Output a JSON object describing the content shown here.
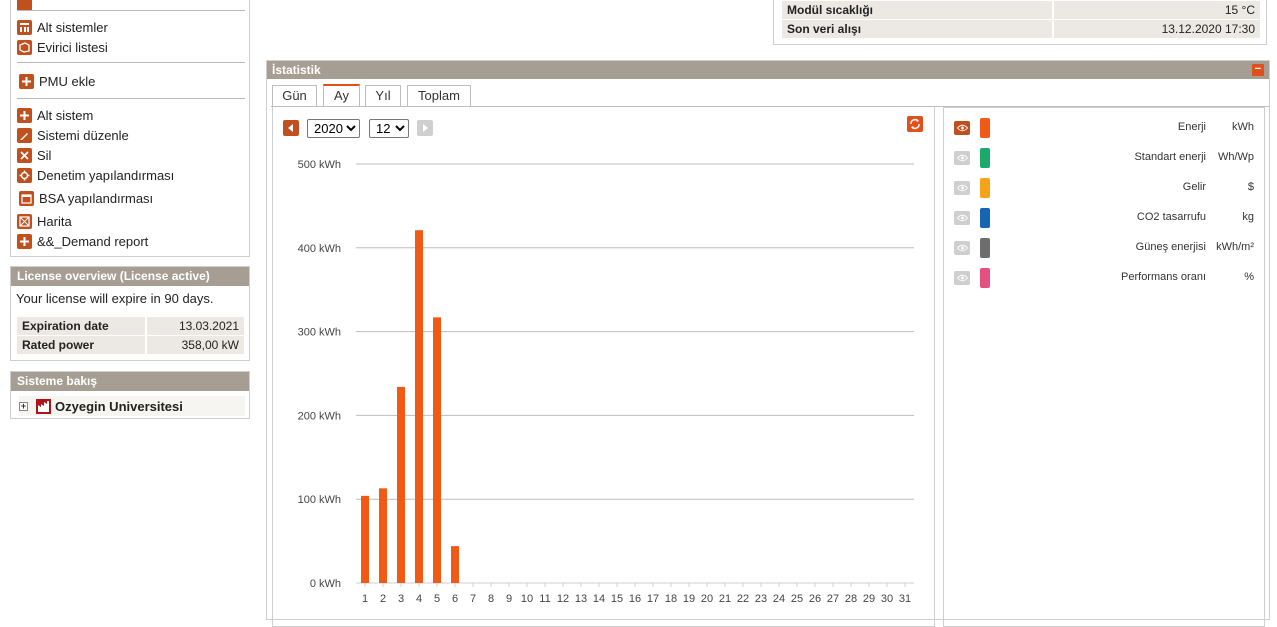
{
  "sidebar": {
    "items": [
      {
        "label": "Alt sistemler",
        "icon": "subsystems-icon"
      },
      {
        "label": "Evirici listesi",
        "icon": "inverter-list-icon"
      },
      {
        "label": "PMU ekle",
        "icon": "plus-icon"
      },
      {
        "label": "Alt sistem",
        "icon": "plus-icon"
      },
      {
        "label": "Sistemi düzenle",
        "icon": "edit-icon"
      },
      {
        "label": "Sil",
        "icon": "delete-icon"
      },
      {
        "label": "Denetim yapılandırması",
        "icon": "gear-icon"
      },
      {
        "label": "BSA yapılandırması",
        "icon": "calendar-icon"
      },
      {
        "label": "Harita",
        "icon": "map-icon"
      },
      {
        "label": "&&_Demand report",
        "icon": "plus-icon"
      }
    ]
  },
  "license": {
    "title": "License overview (License active)",
    "message": "Your license will expire in 90 days.",
    "rows": [
      {
        "key": "Expiration date",
        "value": "13.03.2021"
      },
      {
        "key": "Rated power",
        "value": "358,00 kW"
      }
    ]
  },
  "overview": {
    "title": "Sisteme bakış",
    "system_name": "Ozyegin Universitesi"
  },
  "info": {
    "rows": [
      {
        "key": "Modül sıcaklığı",
        "value": "15 °C"
      },
      {
        "key": "Son veri alışı",
        "value": "13.12.2020 17:30"
      }
    ]
  },
  "stats": {
    "title": "İstatistik",
    "tabs": [
      "Gün",
      "Ay",
      "Yıl",
      "Toplam"
    ],
    "active_tab": "Ay",
    "year": "2020",
    "month": "12",
    "accent": "#e0501a"
  },
  "legend": [
    {
      "name": "Enerji",
      "unit": "kWh",
      "color": "#f05a14",
      "visible": true
    },
    {
      "name": "Standart enerji",
      "unit": "Wh/Wp",
      "color": "#1aab6a",
      "visible": false
    },
    {
      "name": "Gelir",
      "unit": "$",
      "color": "#f7a21b",
      "visible": false
    },
    {
      "name": "CO2 tasarrufu",
      "unit": "kg",
      "color": "#1565b0",
      "visible": false
    },
    {
      "name": "Güneş enerjisi",
      "unit": "kWh/m²",
      "color": "#6e6e6e",
      "visible": false
    },
    {
      "name": "Performans oranı",
      "unit": "%",
      "color": "#e5517f",
      "visible": false
    }
  ],
  "chart_data": {
    "type": "bar",
    "categories": [
      "1",
      "2",
      "3",
      "4",
      "5",
      "6",
      "7",
      "8",
      "9",
      "10",
      "11",
      "12",
      "13",
      "14",
      "15",
      "16",
      "17",
      "18",
      "19",
      "20",
      "21",
      "22",
      "23",
      "24",
      "25",
      "26",
      "27",
      "28",
      "29",
      "30",
      "31"
    ],
    "series": [
      {
        "name": "Enerji",
        "values": [
          104,
          113,
          234,
          421,
          317,
          44,
          0,
          0,
          0,
          0,
          0,
          0,
          0,
          0,
          0,
          0,
          0,
          0,
          0,
          0,
          0,
          0,
          0,
          0,
          0,
          0,
          0,
          0,
          0,
          0,
          0
        ]
      }
    ],
    "y_ticks": [
      "0 kWh",
      "100 kWh",
      "200 kWh",
      "300 kWh",
      "400 kWh",
      "500 kWh"
    ],
    "ylim": [
      0,
      500
    ],
    "grid": true,
    "bar_color": "#f05a14"
  }
}
